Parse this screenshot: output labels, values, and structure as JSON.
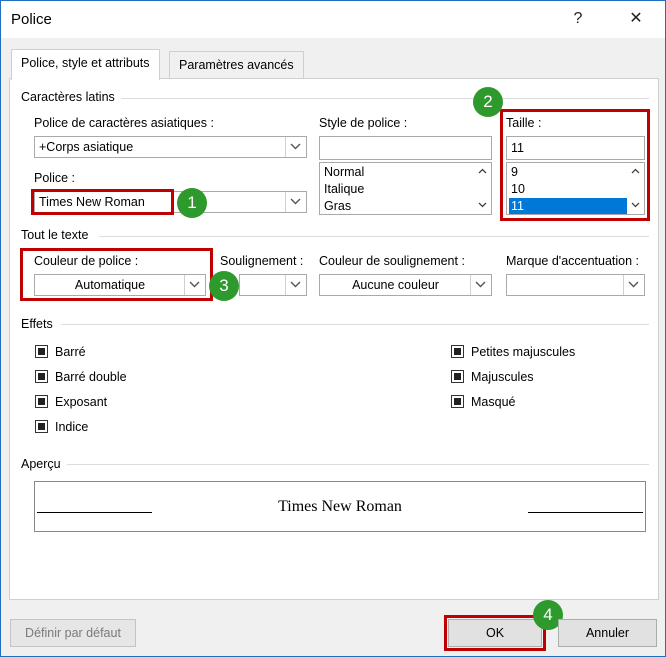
{
  "window": {
    "title": "Police",
    "help_label": "?",
    "close_label": "✕"
  },
  "tabs": [
    {
      "label": "Police, style et attributs"
    },
    {
      "label": "Paramètres avancés"
    }
  ],
  "latin": {
    "section_label": "Caractères latins",
    "asian_font_label": "Police de caractères asiatiques :",
    "asian_font_value": "+Corps asiatique",
    "font_label": "Police :",
    "font_value": "Times New Roman",
    "style_label": "Style de police :",
    "style_value": "",
    "style_options": [
      "Normal",
      "Italique",
      "Gras"
    ],
    "size_label": "Taille :",
    "size_value": "11",
    "size_options": [
      "9",
      "10",
      "11"
    ],
    "size_selected": "11"
  },
  "all_text": {
    "section_label": "Tout le texte",
    "font_color_label": "Couleur de police :",
    "font_color_value": "Automatique",
    "underline_label": "Soulignement :",
    "underline_value": "",
    "underline_color_label": "Couleur de soulignement :",
    "underline_color_value": "Aucune couleur",
    "emphasis_label": "Marque d'accentuation :",
    "emphasis_value": ""
  },
  "effects": {
    "section_label": "Effets",
    "left": [
      "Barré",
      "Barré double",
      "Exposant",
      "Indice"
    ],
    "right": [
      "Petites majuscules",
      "Majuscules",
      "Masqué"
    ]
  },
  "preview": {
    "section_label": "Aperçu",
    "text": "Times New Roman"
  },
  "buttons": {
    "default": "Définir par défaut",
    "ok": "OK",
    "cancel": "Annuler"
  },
  "badges": [
    "1",
    "2",
    "3",
    "4"
  ],
  "colors": {
    "highlight": "#c00000",
    "badge": "#2e9a2e",
    "selection": "#0078d7"
  }
}
